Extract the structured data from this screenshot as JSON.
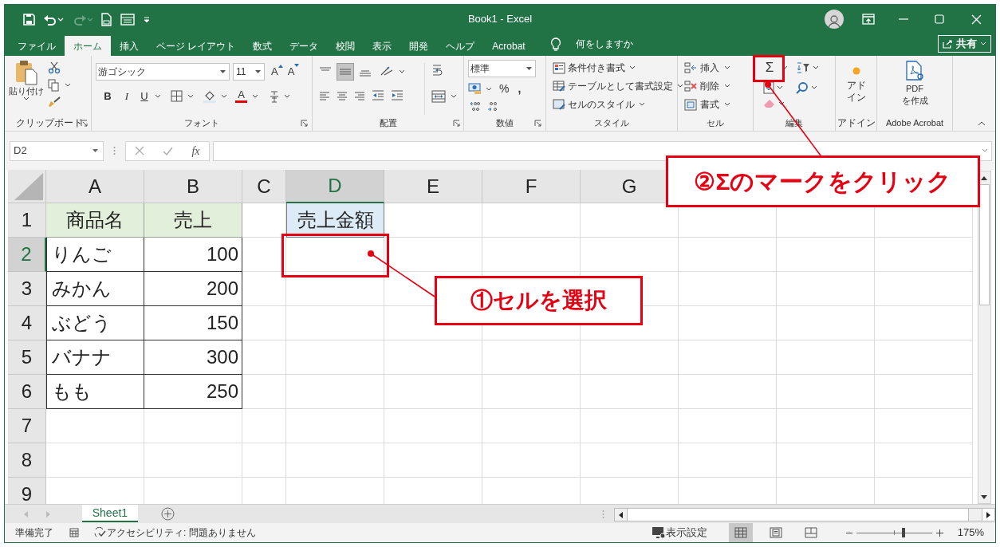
{
  "window": {
    "title": "Book1 - Excel"
  },
  "menu_tabs": [
    {
      "label": "ファイル",
      "selected": false
    },
    {
      "label": "ホーム",
      "selected": true
    },
    {
      "label": "挿入",
      "selected": false
    },
    {
      "label": "ページ レイアウト",
      "selected": false
    },
    {
      "label": "数式",
      "selected": false
    },
    {
      "label": "データ",
      "selected": false
    },
    {
      "label": "校閲",
      "selected": false
    },
    {
      "label": "表示",
      "selected": false
    },
    {
      "label": "開発",
      "selected": false
    },
    {
      "label": "ヘルプ",
      "selected": false
    },
    {
      "label": "Acrobat",
      "selected": false
    }
  ],
  "tell_me": "何をしますか",
  "share_button": "共有",
  "ribbon": {
    "clipboard": {
      "paste": "貼り付け",
      "label": "クリップボード"
    },
    "font": {
      "font_name": "游ゴシック",
      "font_size": "11",
      "grow": "A",
      "shrink": "A",
      "bold": "B",
      "italic": "I",
      "underline": "U",
      "font_color": "A",
      "label": "フォント"
    },
    "alignment": {
      "label": "配置"
    },
    "number": {
      "format": "標準",
      "percent": "%",
      "comma": ",",
      "label": "数値"
    },
    "styles": {
      "items": [
        "条件付き書式",
        "テーブルとして書式設定",
        "セルのスタイル"
      ],
      "label": "スタイル"
    },
    "cells": {
      "items": [
        "挿入",
        "削除",
        "書式"
      ],
      "label": "セル"
    },
    "editing": {
      "autosum": "Σ",
      "label": "編集"
    },
    "addins": {
      "button_lines": [
        "アド",
        "イン"
      ],
      "label": "アドイン"
    },
    "acrobat": {
      "button_lines": [
        "PDF",
        "を作成"
      ],
      "label": "Adobe Acrobat"
    }
  },
  "formula_bar": {
    "name_box": "D2",
    "fx": "fx"
  },
  "columns": [
    {
      "label": "A",
      "selected": false
    },
    {
      "label": "B",
      "selected": false
    },
    {
      "label": "C",
      "selected": false
    },
    {
      "label": "D",
      "selected": true
    },
    {
      "label": "E",
      "selected": false
    },
    {
      "label": "F",
      "selected": false
    },
    {
      "label": "G",
      "selected": false
    }
  ],
  "rows": [
    {
      "number": "1",
      "selected": false,
      "column_a": {
        "text": "商品名",
        "kind": "header"
      },
      "column_b": {
        "text": "売上",
        "kind": "header"
      },
      "column_d": {
        "text": "売上金額",
        "kind": "header_blue"
      }
    },
    {
      "number": "2",
      "selected": true,
      "column_a": {
        "text": "りんご",
        "kind": "text"
      },
      "column_b": {
        "text": "100",
        "kind": "number"
      }
    },
    {
      "number": "3",
      "selected": false,
      "column_a": {
        "text": "みかん",
        "kind": "text"
      },
      "column_b": {
        "text": "200",
        "kind": "number"
      }
    },
    {
      "number": "4",
      "selected": false,
      "column_a": {
        "text": "ぶどう",
        "kind": "text"
      },
      "column_b": {
        "text": "150",
        "kind": "number"
      }
    },
    {
      "number": "5",
      "selected": false,
      "column_a": {
        "text": "バナナ",
        "kind": "text"
      },
      "column_b": {
        "text": "300",
        "kind": "number"
      }
    },
    {
      "number": "6",
      "selected": false,
      "column_a": {
        "text": "もも",
        "kind": "text"
      },
      "column_b": {
        "text": "250",
        "kind": "number"
      }
    },
    {
      "number": "7",
      "selected": false
    },
    {
      "number": "8",
      "selected": false
    },
    {
      "number": "9",
      "selected": false
    }
  ],
  "sheet_tabs": [
    {
      "label": "Sheet1",
      "selected": true
    }
  ],
  "status_bar": {
    "ready": "準備完了",
    "accessibility": "アクセシビリティ: 問題ありません",
    "display_settings": "表示設定",
    "views": [
      {
        "selected": true
      },
      {
        "selected": false
      },
      {
        "selected": false
      }
    ],
    "zoom": {
      "level": 0.62,
      "reading": "175%"
    }
  },
  "annotations": [
    {
      "text": "①セルを選択"
    },
    {
      "text": "②Σのマークをクリック"
    }
  ]
}
